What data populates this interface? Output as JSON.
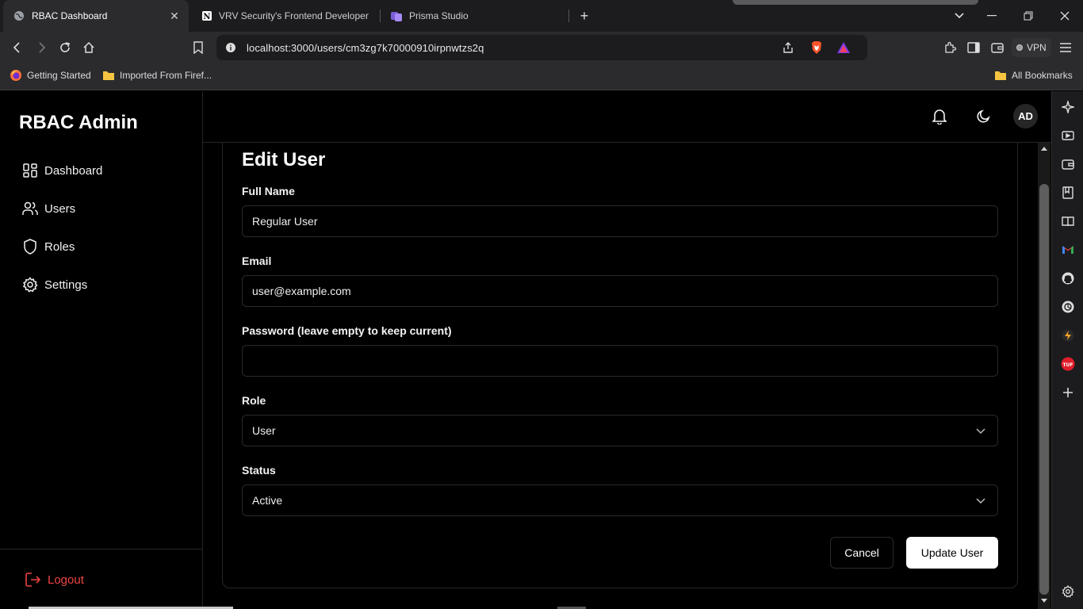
{
  "browser": {
    "tabs": [
      {
        "title": "RBAC Dashboard",
        "active": true
      },
      {
        "title": "VRV Security's Frontend Developer I",
        "active": false
      },
      {
        "title": "Prisma Studio",
        "active": false
      }
    ],
    "url": "localhost:3000/users/cm3zg7k70000910irpnwtzs2q",
    "vpn_label": "VPN",
    "bookmarks": [
      {
        "label": "Getting Started",
        "icon": "firefox-icon"
      },
      {
        "label": "Imported From Firef...",
        "icon": "folder-icon"
      }
    ],
    "all_bookmarks_label": "All Bookmarks"
  },
  "sidebar": {
    "brand": "RBAC Admin",
    "items": [
      {
        "label": "Dashboard",
        "icon": "dashboard-grid-icon"
      },
      {
        "label": "Users",
        "icon": "users-icon"
      },
      {
        "label": "Roles",
        "icon": "shield-icon"
      },
      {
        "label": "Settings",
        "icon": "gear-icon"
      }
    ],
    "logout_label": "Logout"
  },
  "header": {
    "avatar_initials": "AD"
  },
  "form": {
    "title": "Edit User",
    "full_name_label": "Full Name",
    "full_name_value": "Regular User",
    "email_label": "Email",
    "email_value": "user@example.com",
    "password_label": "Password (leave empty to keep current)",
    "password_value": "",
    "role_label": "Role",
    "role_value": "User",
    "status_label": "Status",
    "status_value": "Active",
    "cancel_label": "Cancel",
    "submit_label": "Update User"
  },
  "colors": {
    "background": "#000000",
    "logout": "#ef4444",
    "primary_button": "#ffffff",
    "brave_accent": "#fb542b"
  }
}
